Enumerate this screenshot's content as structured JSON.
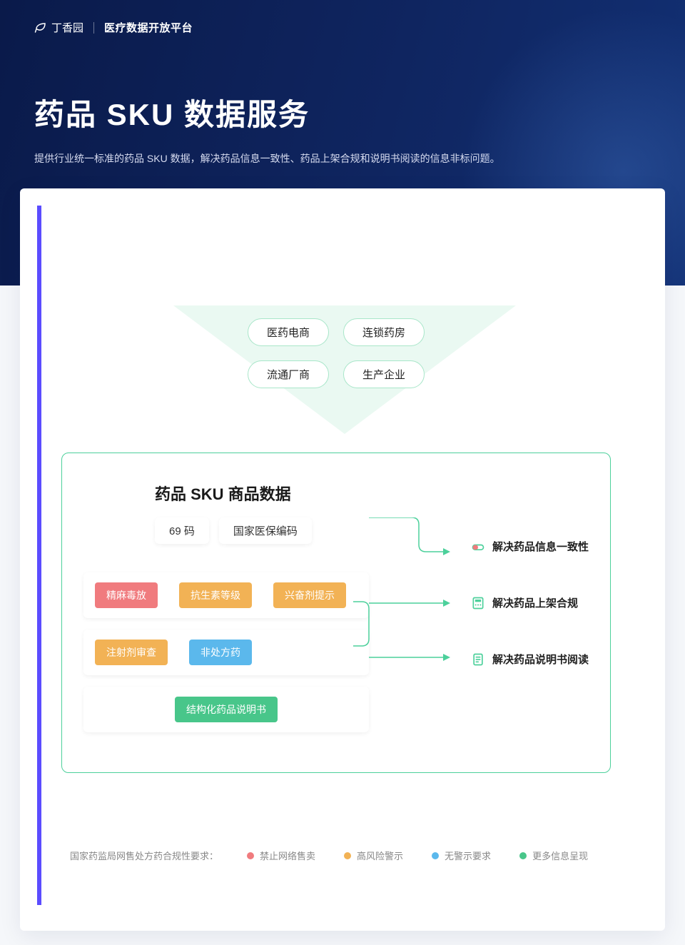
{
  "brand": {
    "name": "丁香园",
    "sub": "医疗数据开放平台"
  },
  "page": {
    "title": "药品 SKU 数据服务",
    "subtitle": "提供行业统一标准的药品 SKU 数据，解决药品信息一致性、药品上架合规和说明书阅读的信息非标问题。"
  },
  "sources": {
    "row1": [
      "医药电商",
      "连锁药房"
    ],
    "row2": [
      "流通厂商",
      "生产企业"
    ]
  },
  "sku": {
    "heading": "药品 SKU 商品数据",
    "codes": [
      "69 码",
      "国家医保编码"
    ],
    "compliance_row1": [
      "精麻毒放",
      "抗生素等级",
      "兴奋剂提示"
    ],
    "compliance_row2": [
      "注射剂审查",
      "非处方药"
    ],
    "doc_row": [
      "结构化药品说明书"
    ]
  },
  "benefits": [
    {
      "label": "解决药品信息一致性",
      "icon": "pill"
    },
    {
      "label": "解决药品上架合规",
      "icon": "calc"
    },
    {
      "label": "解决药品说明书阅读",
      "icon": "doc"
    }
  ],
  "legend": {
    "title": "国家药监局网售处方药合规性要求：",
    "items": [
      {
        "color": "red",
        "label": "禁止网络售卖"
      },
      {
        "color": "ylw",
        "label": "高风险警示"
      },
      {
        "color": "blu",
        "label": "无警示要求"
      },
      {
        "color": "grn",
        "label": "更多信息呈现"
      }
    ]
  }
}
